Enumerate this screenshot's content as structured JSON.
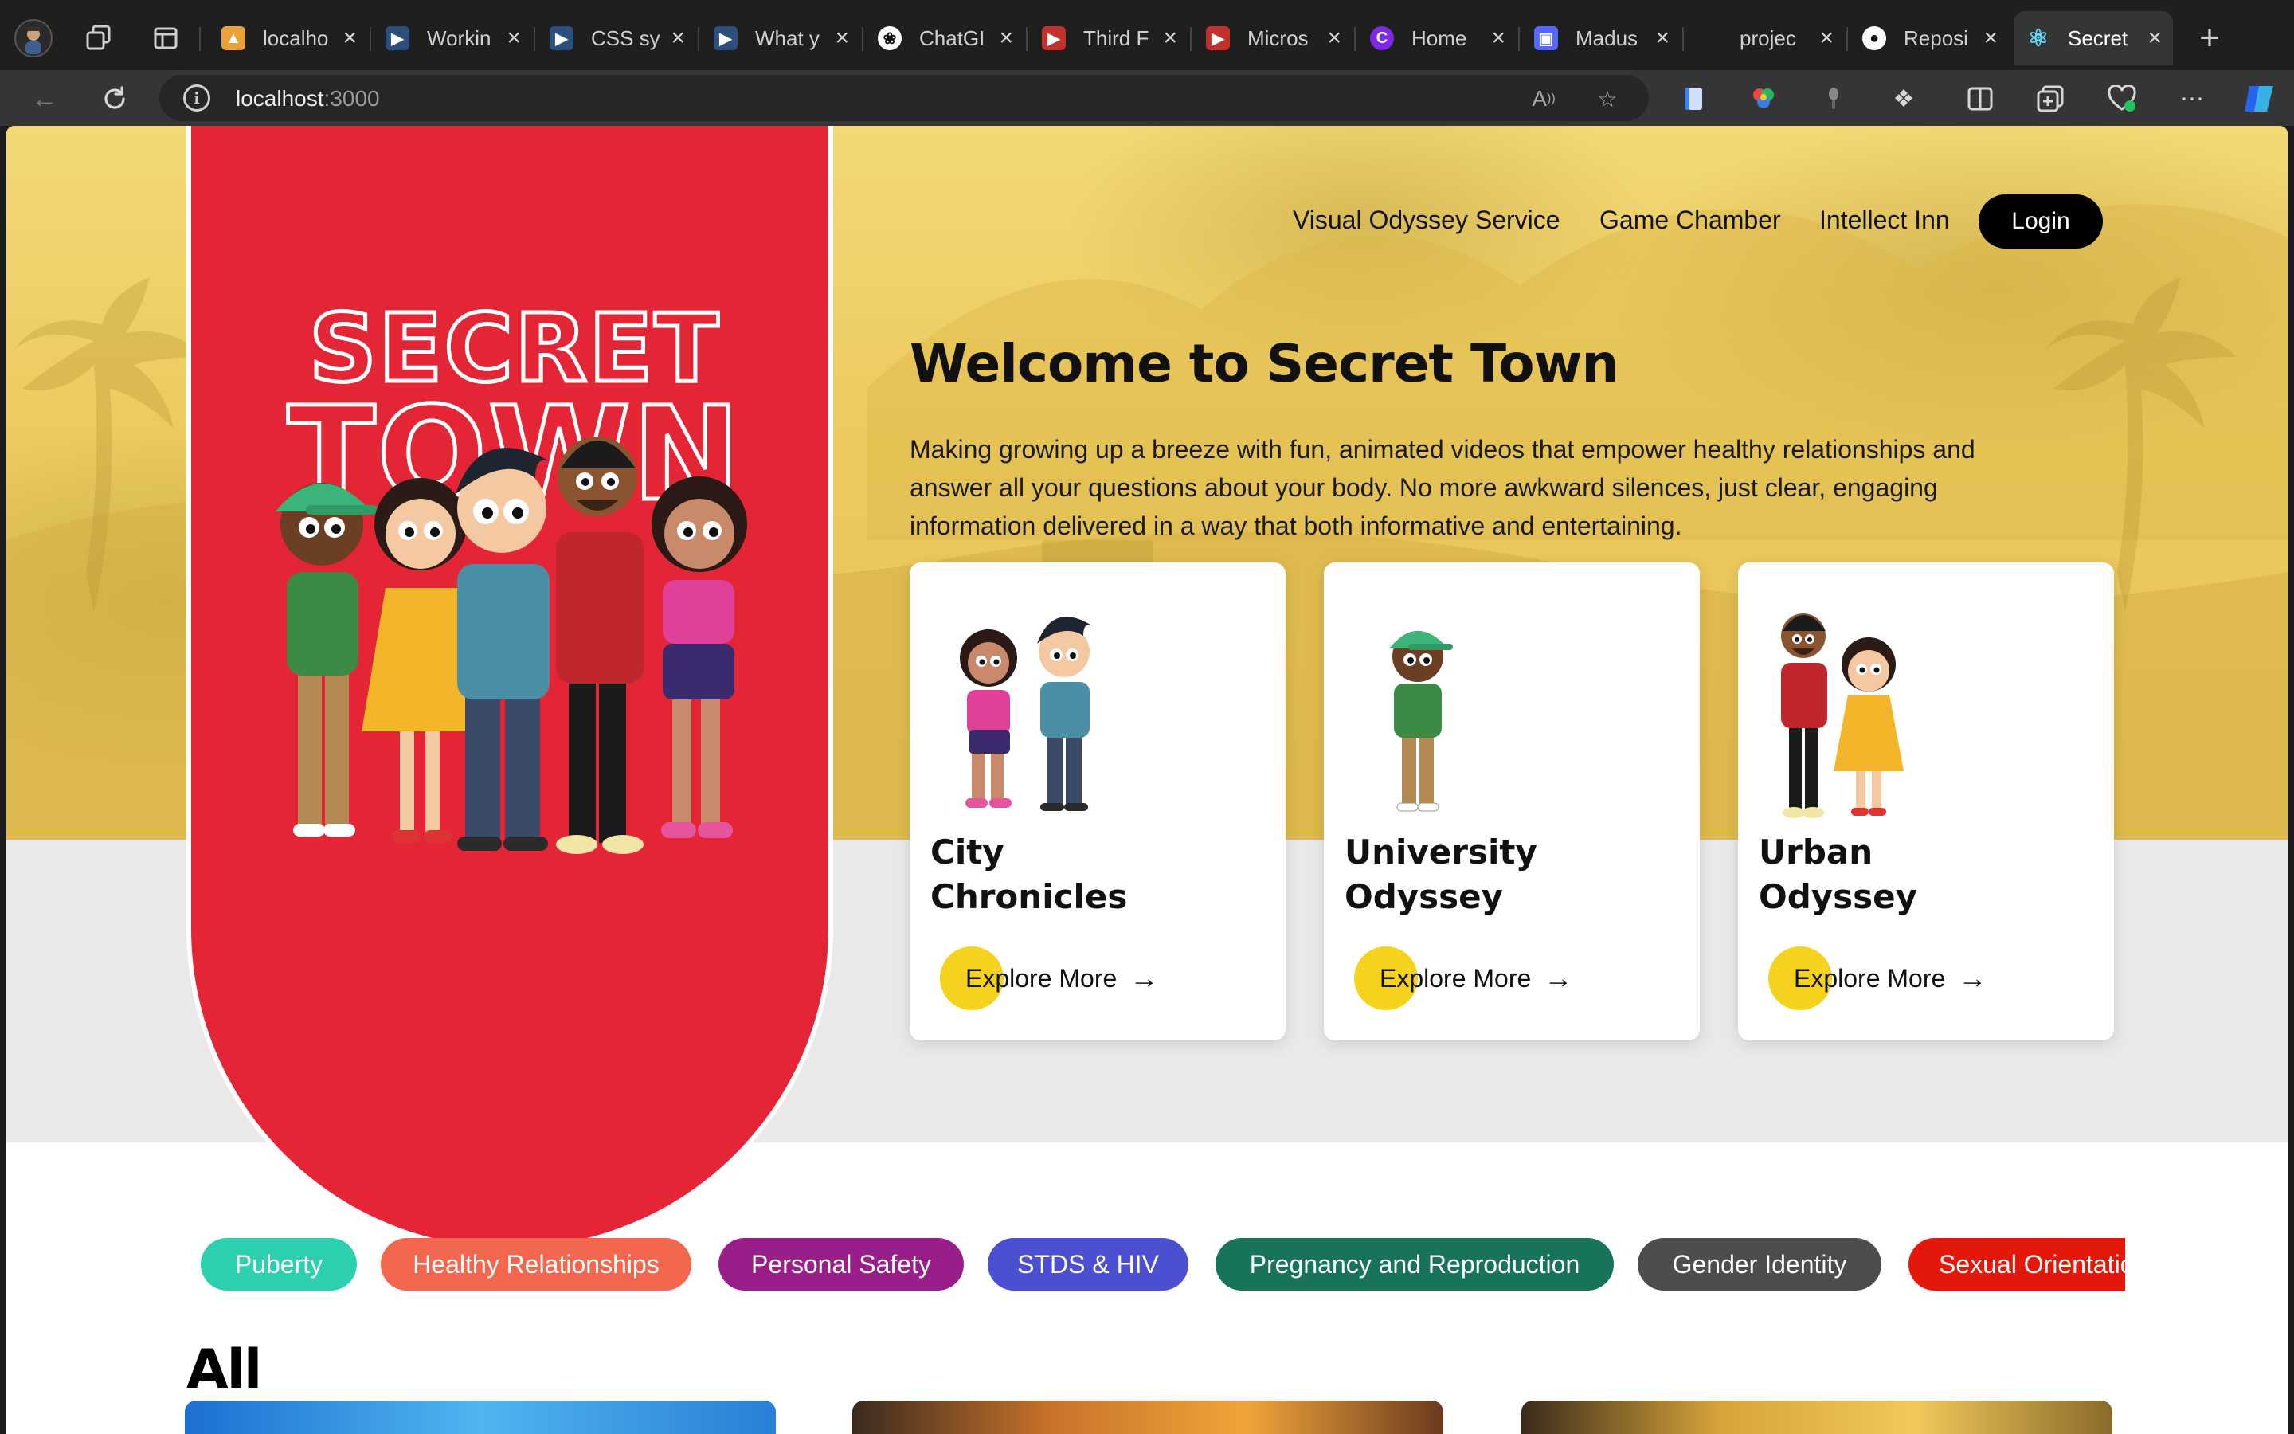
{
  "browser": {
    "tabs": [
      {
        "title": "localho",
        "favicon": "localhost-favicon",
        "color": "#e9a23b"
      },
      {
        "title": "Workin",
        "favicon": "video-favicon",
        "color": "#2c4f7c"
      },
      {
        "title": "CSS sy",
        "favicon": "video-favicon",
        "color": "#2c4f7c"
      },
      {
        "title": "What y",
        "favicon": "video-favicon",
        "color": "#2c4f7c"
      },
      {
        "title": "ChatGI",
        "favicon": "chatgpt-favicon",
        "color": "#ffffff"
      },
      {
        "title": "Third F",
        "favicon": "youtube-favicon",
        "color": "#c4302b"
      },
      {
        "title": "Micros",
        "favicon": "youtube-favicon",
        "color": "#c4302b"
      },
      {
        "title": "Home",
        "favicon": "canva-favicon",
        "color": "#7d2ae8"
      },
      {
        "title": "Madus",
        "favicon": "app-favicon",
        "color": "#5468ff"
      },
      {
        "title": "projec",
        "favicon": "blank-favicon",
        "color": "#1f1f1f"
      },
      {
        "title": "Reposi",
        "favicon": "github-favicon",
        "color": "#ffffff"
      },
      {
        "title": "Secret",
        "favicon": "react-favicon",
        "color": "#61dafb"
      }
    ],
    "address": {
      "host": "localhost",
      "port": ":3000"
    }
  },
  "nav": {
    "links": [
      "Visual Odyssey Service",
      "Game Chamber",
      "Intellect Inn"
    ],
    "login": "Login"
  },
  "logo": {
    "line1": "SECRET",
    "line2": "TOWN"
  },
  "hero": {
    "title": "Welcome to Secret Town",
    "intro": "Making growing up a breeze with fun, animated videos that empower healthy relationships and answer all your questions about your body. No more awkward silences, just clear, engaging information delivered in a way that both informative and entertaining."
  },
  "cards": [
    {
      "title": "City Chronicles",
      "cta": "Explore More"
    },
    {
      "title": "University Odyssey",
      "cta": "Explore More"
    },
    {
      "title": "Urban Odyssey",
      "cta": "Explore More"
    }
  ],
  "categories": [
    {
      "label": "Puberty",
      "color": "#2ccfae"
    },
    {
      "label": "Healthy Relationships",
      "color": "#f2674e"
    },
    {
      "label": "Personal Safety",
      "color": "#9a1e8a"
    },
    {
      "label": "STDS & HIV",
      "color": "#4b4fd0"
    },
    {
      "label": "Pregnancy and Reproduction",
      "color": "#17735a"
    },
    {
      "label": "Gender Identity",
      "color": "#4d4d4d"
    },
    {
      "label": "Sexual Orientation",
      "color": "#e3170a"
    }
  ],
  "section": {
    "heading": "All"
  }
}
